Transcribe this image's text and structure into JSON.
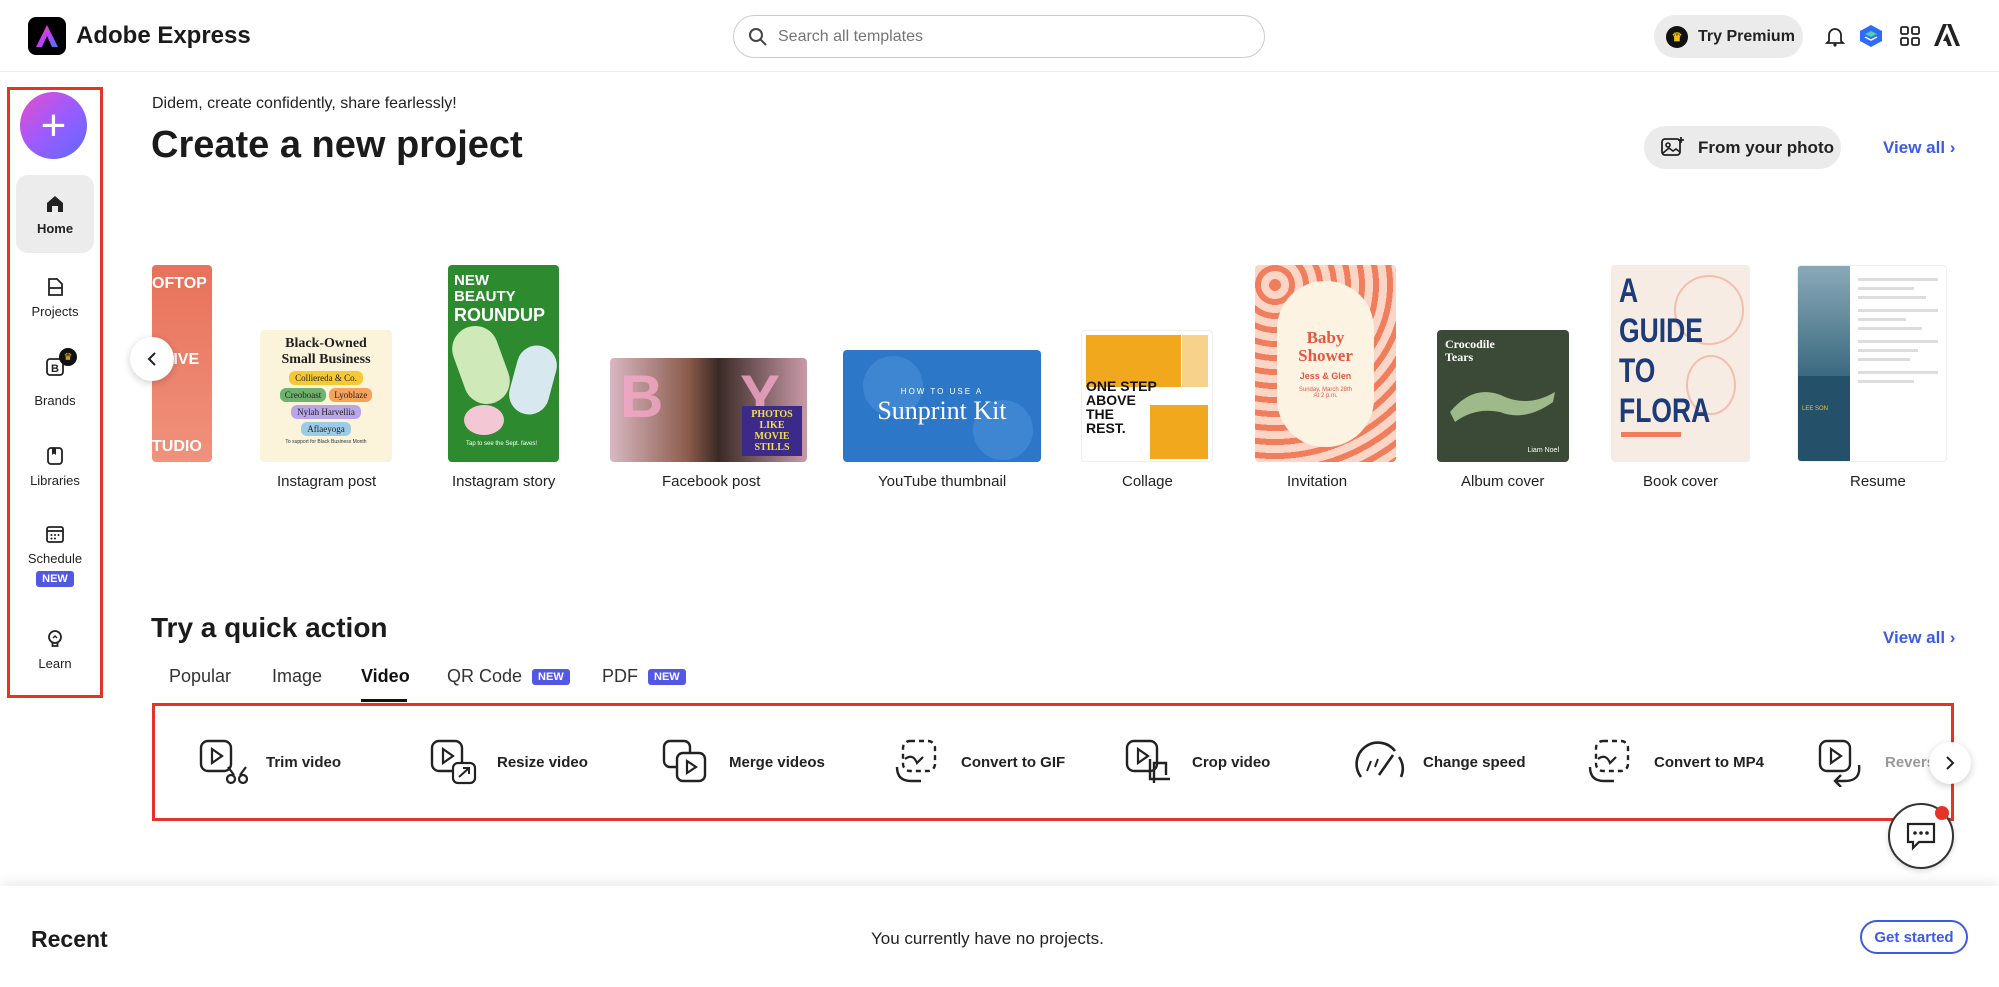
{
  "app": {
    "name": "Adobe Express"
  },
  "search": {
    "placeholder": "Search all templates"
  },
  "header": {
    "premium_label": "Try Premium"
  },
  "sidebar": {
    "items": [
      {
        "label": "Home"
      },
      {
        "label": "Projects"
      },
      {
        "label": "Brands"
      },
      {
        "label": "Libraries"
      },
      {
        "label": "Schedule",
        "badge": "NEW"
      },
      {
        "label": "Learn"
      }
    ]
  },
  "main": {
    "greeting": "Didem, create confidently, share fearlessly!",
    "title": "Create a new project",
    "from_photo": "From your photo",
    "view_all": "View all",
    "templates": [
      {
        "label": "Instagram post",
        "text": [
          "Black-Owned",
          "Small Business",
          "Colliereda & Co.",
          "Creoboast",
          "Lyoblaze",
          "Nylah Harvellia",
          "Aflaeyoga",
          "To support for Black Business Month"
        ]
      },
      {
        "label": "Instagram story",
        "text": [
          "NEW BEAUTY",
          "ROUNDUP",
          "Tap to see the Sept. faves!"
        ]
      },
      {
        "label": "Facebook post",
        "text": [
          "PHOTOS LIKE",
          "MOVIE STILLS"
        ]
      },
      {
        "label": "YouTube thumbnail",
        "text": [
          "HOW TO USE A",
          "Sunprint Kit"
        ]
      },
      {
        "label": "Collage",
        "text": [
          "ONE STEP",
          "ABOVE",
          "THE",
          "REST."
        ]
      },
      {
        "label": "Invitation",
        "text": [
          "Baby",
          "Shower",
          "Jess & Glen",
          "Sunday, March 28th",
          "At 2 p.m."
        ]
      },
      {
        "label": "Album cover",
        "text": [
          "Crocodile",
          "Tears",
          "Liam Noel"
        ]
      },
      {
        "label": "Book cover",
        "text": [
          "A",
          "GUIDE",
          "TO",
          "FLORA"
        ]
      },
      {
        "label": "Resume",
        "text": [
          "LEE SON"
        ]
      }
    ],
    "partial_template_text": [
      "OFTOP",
      "CTIVE",
      "TUDIO"
    ]
  },
  "quick_actions": {
    "title": "Try a quick action",
    "view_all": "View all",
    "tabs": [
      {
        "label": "Popular"
      },
      {
        "label": "Image"
      },
      {
        "label": "Video",
        "active": true
      },
      {
        "label": "QR Code",
        "badge": "NEW"
      },
      {
        "label": "PDF",
        "badge": "NEW"
      }
    ],
    "items": [
      {
        "label": "Trim video"
      },
      {
        "label": "Resize video"
      },
      {
        "label": "Merge videos"
      },
      {
        "label": "Convert to GIF"
      },
      {
        "label": "Crop video"
      },
      {
        "label": "Change speed"
      },
      {
        "label": "Convert to MP4"
      },
      {
        "label": "Revers"
      }
    ]
  },
  "recent": {
    "title": "Recent",
    "message": "You currently have no projects.",
    "cta": "Get started"
  },
  "colors": {
    "accent": "#3d5ae6",
    "highlight": "#e4342a",
    "badge": "#5258e4"
  }
}
